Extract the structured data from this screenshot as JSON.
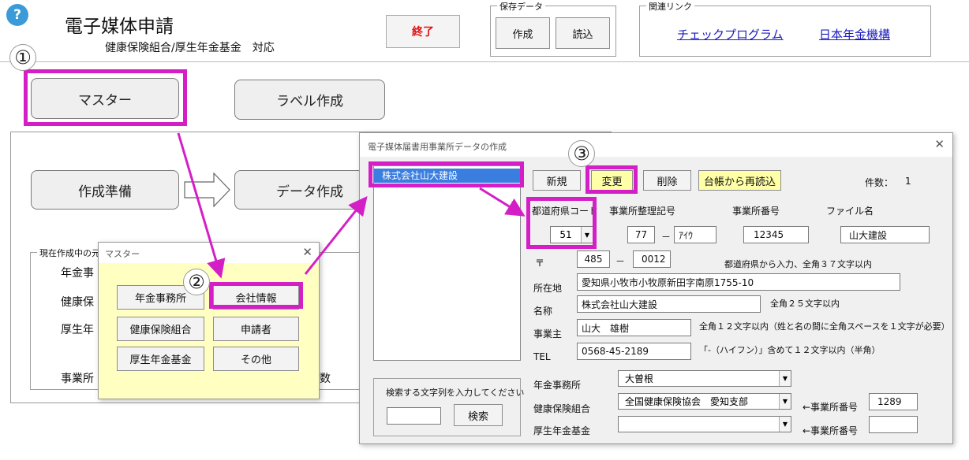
{
  "header": {
    "help_icon": "?",
    "title": "電子媒体申請",
    "subtitle": "健康保険組合/厚生年金基金　対応",
    "exit_label": "終了"
  },
  "save_data": {
    "title": "保存データ",
    "create": "作成",
    "load": "読込"
  },
  "links": {
    "title": "関連リンク",
    "check": "チェックプログラム",
    "nenkin": "日本年金機構"
  },
  "main": {
    "master": "マスター",
    "label_create": "ラベル作成",
    "prepare": "作成準備",
    "data_create": "データ作成",
    "group_title": "現在作成中の元",
    "row1": "年金事",
    "row2": "健康保",
    "row3": "厚生年",
    "row4": "事業所",
    "row4_suffix": "数"
  },
  "master_dialog": {
    "title": "マスター",
    "btn_nenkin_office": "年金事務所",
    "btn_company": "会社情報",
    "btn_health": "健康保険組合",
    "btn_applicant": "申請者",
    "btn_pension_fund": "厚生年金基金",
    "btn_other": "その他"
  },
  "office_dialog": {
    "title": "電子媒体届書用事業所データの作成",
    "list_selected": "株式会社山大建設",
    "btn_new": "新規",
    "btn_change": "変更",
    "btn_delete": "削除",
    "btn_reload": "台帳から再読込",
    "count_label": "件数：",
    "count_value": "1",
    "pref_code_label": "都道府県コード",
    "pref_code_value": "51",
    "office_sort_label": "事業所整理記号",
    "office_sort_1": "77",
    "office_sort_dash": "－",
    "office_sort_2": "ｱｲｳ",
    "office_no_label": "事業所番号",
    "office_no_value": "12345",
    "file_label": "ファイル名",
    "file_value": "山大建設",
    "postal_label": "〒",
    "postal_1": "485",
    "postal_dash": "－",
    "postal_2": "0012",
    "address_hint": "都道府県から入力、全角３７文字以内",
    "address_label": "所在地",
    "address_value": "愛知県小牧市小牧原新田字南原1755-10",
    "name_label": "名称",
    "name_value": "株式会社山大建設",
    "name_hint": "全角２５文字以内",
    "owner_label": "事業主",
    "owner_value": "山大　雄樹",
    "owner_hint": "全角１２文字以内（姓と名の間に全角スペースを１文字が必要）",
    "tel_label": "TEL",
    "tel_value": "0568-45-2189",
    "tel_hint": "「-（ハイフン）」含めて１２文字以内（半角）",
    "search_label": "検索する文字列を入力してください",
    "search_btn": "検索",
    "nenkin_office_label": "年金事務所",
    "nenkin_office_value": "大曽根",
    "health_label": "健康保険組合",
    "health_value": "全国健康保険協会　愛知支部",
    "health_no_label": "←事業所番号",
    "health_no_value": "1289",
    "pension_label": "厚生年金基金",
    "pension_value": "",
    "pension_no_label": "←事業所番号",
    "pension_no_value": ""
  },
  "steps": {
    "s1": "①",
    "s2": "②",
    "s3": "③"
  },
  "colors": {
    "marker": "#d41fc6",
    "highlight": "#ffffa8",
    "selected": "#3a7ee0",
    "dialog_bg": "#f0f0f0"
  }
}
